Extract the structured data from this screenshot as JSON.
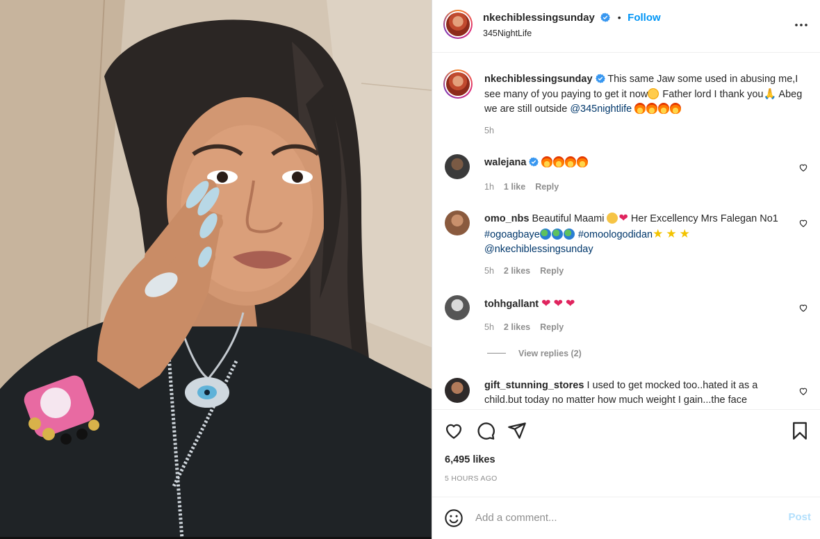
{
  "post": {
    "username": "nkechiblessingsunday",
    "follow_label": "Follow",
    "dot": "•",
    "location": "345NightLife",
    "more_icon": "more-horizontal-icon"
  },
  "caption": {
    "username": "nkechiblessingsunday",
    "text_1": "This same Jaw some used in abusing me,I see many of you paying to get it now",
    "text_2": " Father lord I thank you",
    "text_3": " Abeg we are still outside ",
    "mention": "@345nightlife",
    "time": "5h"
  },
  "comments": [
    {
      "username": "walejana",
      "text": "",
      "time": "1h",
      "likes": "1 like",
      "reply": "Reply"
    },
    {
      "username": "omo_nbs",
      "text_1": "Beautiful Maami ",
      "text_2": " Her Excellency Mrs Falegan No1 ",
      "tag_1": "#ogoagbaye",
      "tag_2": "#omoologodidan",
      "mention": "@nkechiblessingsunday",
      "time": "5h",
      "likes": "2 likes",
      "reply": "Reply"
    },
    {
      "username": "tohhgallant",
      "text": "",
      "time": "5h",
      "likes": "2 likes",
      "reply": "Reply",
      "view_replies": "View replies (2)"
    },
    {
      "username": "gift_stunning_stores",
      "text": "I used to get mocked too..hated it as a child.but today no matter how much weight I gain...the face"
    }
  ],
  "footer": {
    "likes": "6,495 likes",
    "timestamp": "5 HOURS AGO",
    "comment_placeholder": "Add a comment...",
    "post_label": "Post"
  },
  "colors": {
    "accent": "#0095f6",
    "secondary_text": "#8e8e8e",
    "hashtag": "#00376b",
    "post_disabled": "#b2dffc"
  }
}
